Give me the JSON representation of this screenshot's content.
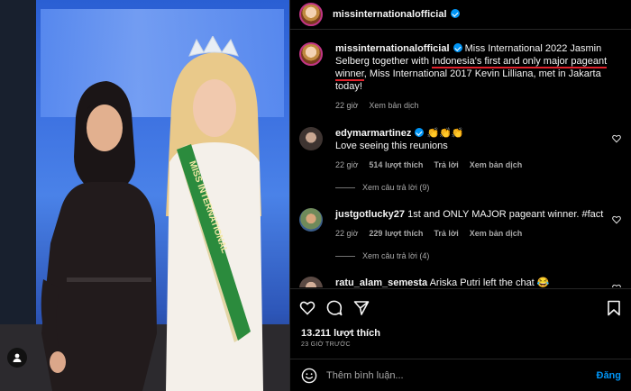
{
  "post": {
    "username": "missinternationalofficial",
    "caption_before": " Miss International 2022 Jasmin Selberg together with ",
    "caption_highlight": "Indonesia's first and only major pageant winner",
    "caption_after": ", Miss International 2017 Kevin Lilliana, met in Jakarta today!",
    "caption_time": "22 giờ",
    "caption_translate": "Xem bản dịch",
    "photo_sash_text": "MISS INTERNATIONAL"
  },
  "comments": [
    {
      "username": "edymarmartinez",
      "text_prefix": "👏👏👏",
      "text": "Love seeing this reunions",
      "time": "22 giờ",
      "likes": "514 lượt thích",
      "reply": "Trả lời",
      "translate": "Xem bản dịch",
      "view_replies": "Xem câu trả lời (9)"
    },
    {
      "username": "justgotlucky27",
      "text": "1st and ONLY MAJOR pageant winner. #fact",
      "time": "22 giờ",
      "likes": "229 lượt thích",
      "reply": "Trả lời",
      "translate": "Xem bản dịch",
      "view_replies": "Xem câu trả lời (4)"
    },
    {
      "username": "ratu_alam_semesta",
      "text": "Ariska Putri left the chat 😂"
    }
  ],
  "actions": {
    "likes": "13.211 lượt thích",
    "ago": "23 GIỜ TRƯỚC"
  },
  "compose": {
    "placeholder": "Thêm bình luận...",
    "post_label": "Đăng"
  },
  "colors": {
    "verified": "#0095f6",
    "highlight_underline": "#e0212b",
    "post_button": "#0095f6"
  }
}
